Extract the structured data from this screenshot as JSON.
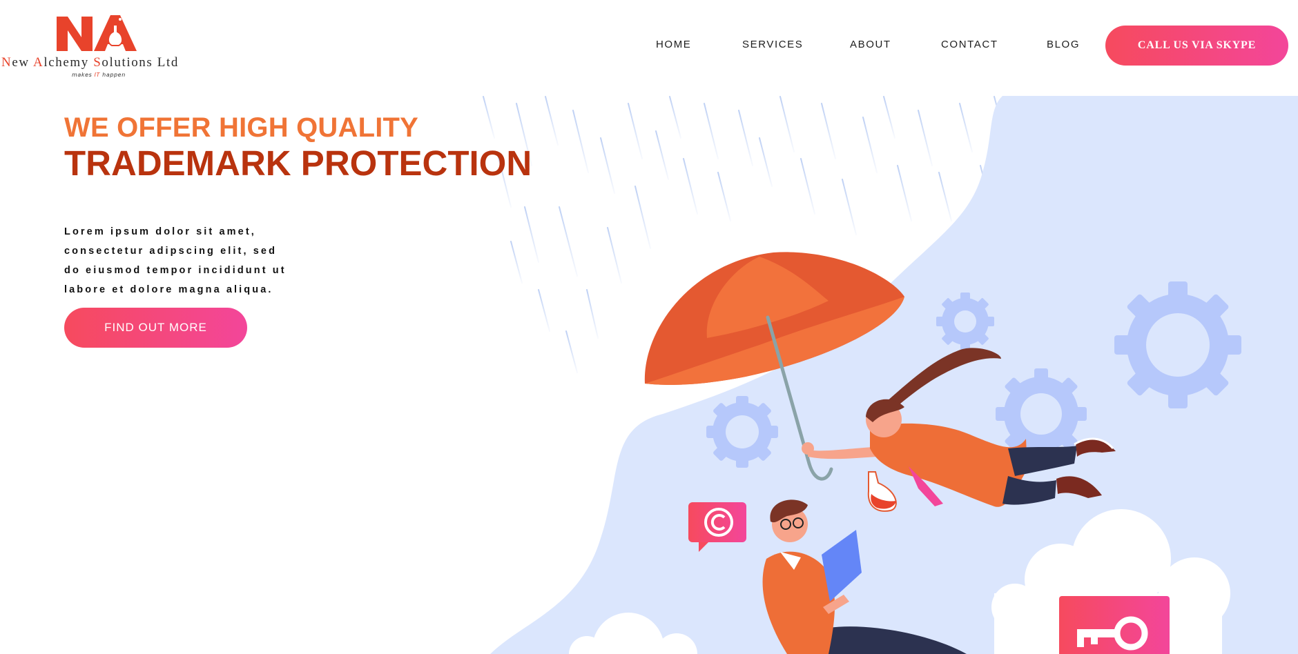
{
  "brand": {
    "name_parts": [
      {
        "text": "N",
        "accent": true
      },
      {
        "text": "ew ",
        "accent": false
      },
      {
        "text": "A",
        "accent": true
      },
      {
        "text": "lchemy ",
        "accent": false
      },
      {
        "text": "S",
        "accent": true
      },
      {
        "text": "olutions Ltd",
        "accent": false
      }
    ],
    "tagline_parts": [
      {
        "text": "makes ",
        "accent": false
      },
      {
        "text": "IT",
        "accent": true
      },
      {
        "text": " happen",
        "accent": false
      }
    ],
    "accent_color": "#e8432b"
  },
  "nav": {
    "items": [
      {
        "label": "HOME"
      },
      {
        "label": "SERVICES"
      },
      {
        "label": "ABOUT"
      },
      {
        "label": "CONTACT"
      },
      {
        "label": "BLOG"
      }
    ],
    "cta_label": "CALL US VIA SKYPE"
  },
  "hero": {
    "subtitle": "WE OFFER HIGH QUALITY",
    "title": "TRADEMARK PROTECTION",
    "body_lines": [
      "Lorem ipsum dolor sit amet,",
      "consectetur adipscing elit, sed",
      "do eiusmod tempor incididunt ut",
      "labore et dolore magna aliqua."
    ],
    "cta_label": "FIND OUT MORE"
  },
  "illustration": {
    "icons": [
      "umbrella-icon",
      "gear-icon",
      "copyright-icon",
      "key-icon",
      "cloud-icon",
      "laptop-icon",
      "flask-icon"
    ],
    "colors": {
      "background_blob": "#dbe6fd",
      "gear": "#b6c8fb",
      "umbrella_dark": "#e45931",
      "umbrella_light": "#f2723c",
      "badge_gradient_start": "#f64a5e",
      "badge_gradient_end": "#f3469a",
      "rain": "#b7cbf3"
    }
  }
}
